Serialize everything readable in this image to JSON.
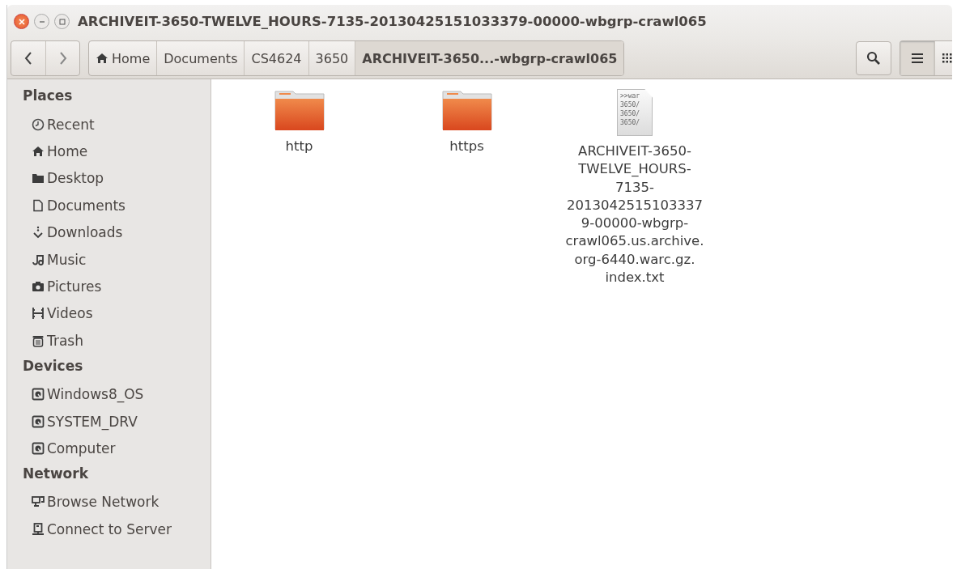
{
  "window": {
    "title": "ARCHIVEIT-3650-TWELVE_HOURS-7135-20130425151033379-00000-wbgrp-crawl065"
  },
  "path_bar": [
    {
      "label": "Home",
      "kind": "home",
      "selected": false
    },
    {
      "label": "Documents",
      "kind": "folder",
      "selected": false
    },
    {
      "label": "CS4624",
      "kind": "folder",
      "selected": false
    },
    {
      "label": "3650",
      "kind": "folder",
      "selected": false
    },
    {
      "label": "ARCHIVEIT-3650...-wbgrp-crawl065",
      "kind": "folder",
      "selected": true
    }
  ],
  "view_buttons": [
    {
      "kind": "list",
      "selected": true
    },
    {
      "kind": "grid",
      "selected": false
    }
  ],
  "sidebar": [
    {
      "heading": "Places",
      "items": [
        {
          "label": "Recent",
          "kind": "clock"
        },
        {
          "label": "Home",
          "kind": "home"
        },
        {
          "label": "Desktop",
          "kind": "folder"
        },
        {
          "label": "Documents",
          "kind": "document"
        },
        {
          "label": "Downloads",
          "kind": "download"
        },
        {
          "label": "Music",
          "kind": "music"
        },
        {
          "label": "Pictures",
          "kind": "camera"
        },
        {
          "label": "Videos",
          "kind": "film"
        },
        {
          "label": "Trash",
          "kind": "trash"
        }
      ]
    },
    {
      "heading": "Devices",
      "items": [
        {
          "label": "Windows8_OS",
          "kind": "drive"
        },
        {
          "label": "SYSTEM_DRV",
          "kind": "drive"
        },
        {
          "label": "Computer",
          "kind": "drive"
        }
      ]
    },
    {
      "heading": "Network",
      "items": [
        {
          "label": "Browse Network",
          "kind": "network"
        },
        {
          "label": "Connect to Server",
          "kind": "server"
        }
      ]
    }
  ],
  "files": [
    {
      "kind": "folder",
      "name_lines": [
        "http"
      ]
    },
    {
      "kind": "folder",
      "name_lines": [
        "https"
      ]
    },
    {
      "kind": "text",
      "preview_lines": [
        ">>war",
        "3650/",
        "3650/",
        "3650/"
      ],
      "name_lines": [
        "ARCHIVEIT-3650-",
        "TWELVE_HOURS-",
        "7135-",
        "2013042515103337",
        "9-00000-wbgrp-",
        "crawl065.us.archive.",
        "org-6440.warc.gz.",
        "index.txt"
      ]
    }
  ]
}
